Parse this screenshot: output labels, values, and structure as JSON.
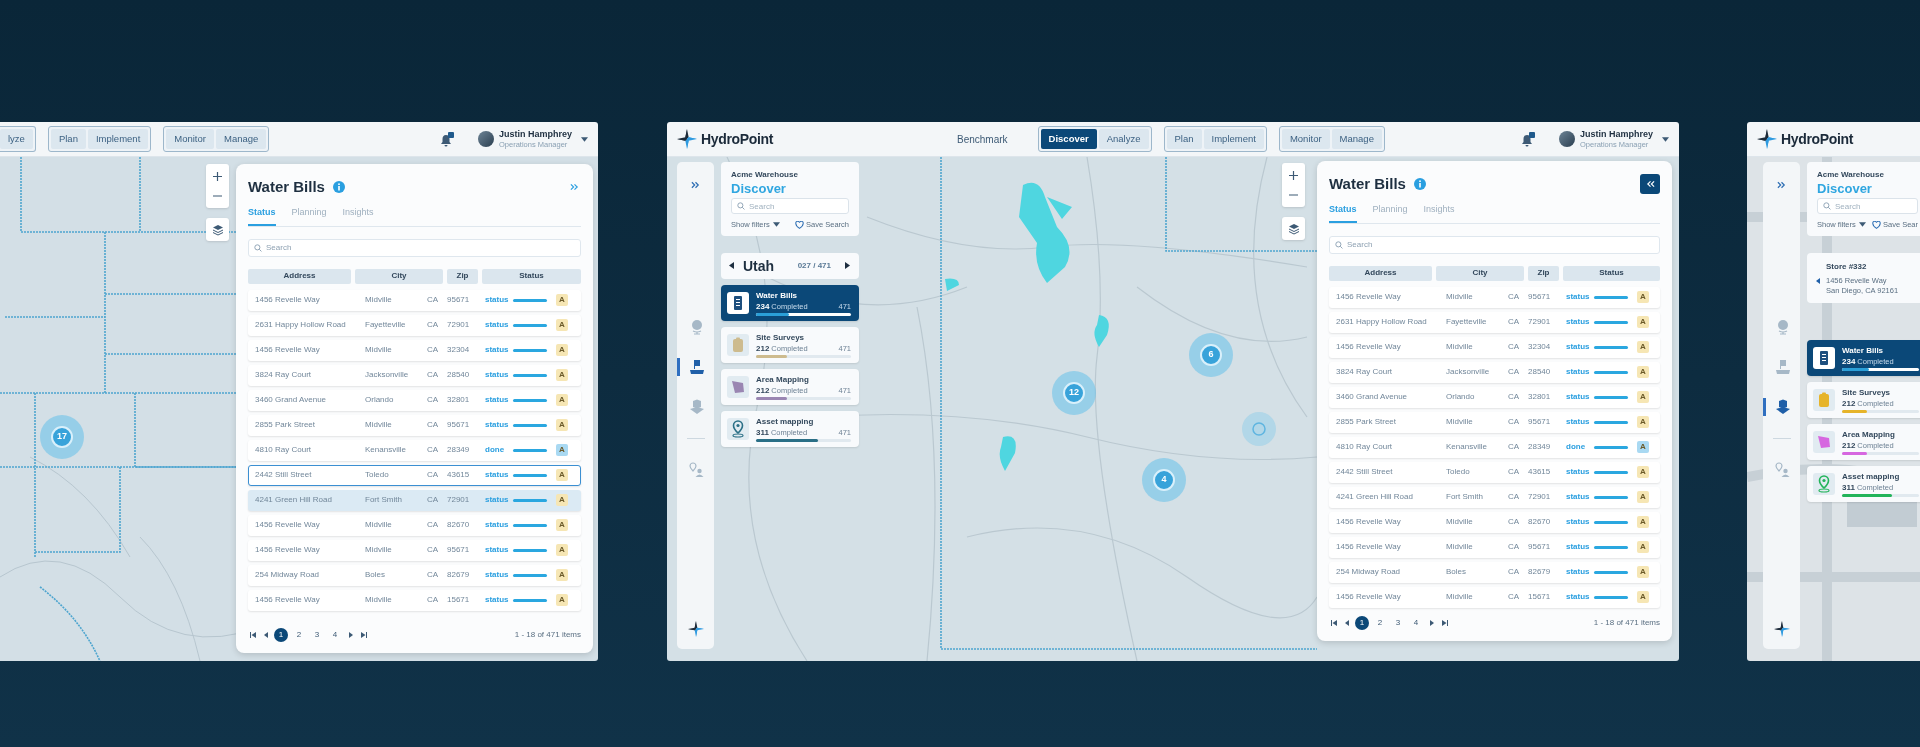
{
  "screens": [
    {
      "kind": "table_view",
      "header": {
        "nav_groups": [
          [
            {
              "label": "lyze",
              "selected": false
            }
          ],
          [
            {
              "label": "Plan",
              "selected": false
            },
            {
              "label": "Implement",
              "selected": false
            }
          ],
          [
            {
              "label": "Monitor",
              "selected": false
            },
            {
              "label": "Manage",
              "selected": false
            }
          ]
        ],
        "notification": true,
        "user": {
          "name": "Justin Hamphrey",
          "role": "Operations Manager"
        }
      },
      "map": {
        "clusters": [
          {
            "label": "17"
          }
        ]
      },
      "panel": {
        "title": "Water Bills",
        "toggle_active": false,
        "tabs": [
          {
            "label": "Status",
            "selected": true
          },
          {
            "label": "Planning",
            "selected": false
          },
          {
            "label": "Insights",
            "selected": false
          }
        ],
        "search_placeholder": "Search",
        "columns": [
          "Address",
          "City",
          "Zip",
          "Status"
        ],
        "rows": [
          {
            "address": "1456 Revelle Way",
            "city": "Midville",
            "state": "CA",
            "zip": "95671",
            "status": "status",
            "badge": "A",
            "color": "#f6e6b4",
            "selected": false,
            "hovered": false
          },
          {
            "address": "2631 Happy Hollow Road",
            "city": "Fayetteville",
            "state": "CA",
            "zip": "72901",
            "status": "status",
            "badge": "A",
            "color": "#f6e6b4",
            "selected": false,
            "hovered": false
          },
          {
            "address": "1456 Revelle Way",
            "city": "Midville",
            "state": "CA",
            "zip": "32304",
            "status": "status",
            "badge": "A",
            "color": "#f6e6b4",
            "selected": false,
            "hovered": false
          },
          {
            "address": "3824 Ray Court",
            "city": "Jacksonville",
            "state": "CA",
            "zip": "28540",
            "status": "status",
            "badge": "A",
            "color": "#f6e6b4",
            "selected": false,
            "hovered": false
          },
          {
            "address": "3460 Grand Avenue",
            "city": "Orlando",
            "state": "CA",
            "zip": "32801",
            "status": "status",
            "badge": "A",
            "color": "#f6e6b4",
            "selected": false,
            "hovered": false
          },
          {
            "address": "2855 Park Street",
            "city": "Midville",
            "state": "CA",
            "zip": "95671",
            "status": "status",
            "badge": "A",
            "color": "#f6e6b4",
            "selected": false,
            "hovered": false
          },
          {
            "address": "4810 Ray Court",
            "city": "Kenansville",
            "state": "CA",
            "zip": "28349",
            "status": "done",
            "badge": "A",
            "color": "#a9d9f2",
            "selected": false,
            "hovered": false
          },
          {
            "address": "2442 Still Street",
            "city": "Toledo",
            "state": "CA",
            "zip": "43615",
            "status": "status",
            "badge": "A",
            "color": "#f6e6b4",
            "selected": true,
            "hovered": false
          },
          {
            "address": "4241 Green Hill Road",
            "city": "Fort Smith",
            "state": "CA",
            "zip": "72901",
            "status": "status",
            "badge": "A",
            "color": "#f6e6b4",
            "selected": false,
            "hovered": true
          },
          {
            "address": "1456 Revelle Way",
            "city": "Midville",
            "state": "CA",
            "zip": "82670",
            "status": "status",
            "badge": "A",
            "color": "#f6e6b4",
            "selected": false,
            "hovered": false
          },
          {
            "address": "1456 Revelle Way",
            "city": "Midville",
            "state": "CA",
            "zip": "95671",
            "status": "status",
            "badge": "A",
            "color": "#f6e6b4",
            "selected": false,
            "hovered": false
          },
          {
            "address": "254 Midway Road",
            "city": "Boles",
            "state": "CA",
            "zip": "82679",
            "status": "status",
            "badge": "A",
            "color": "#f6e6b4",
            "selected": false,
            "hovered": false
          },
          {
            "address": "1456 Revelle Way",
            "city": "Midville",
            "state": "CA",
            "zip": "15671",
            "status": "status",
            "badge": "A",
            "color": "#f6e6b4",
            "selected": false,
            "hovered": false
          }
        ],
        "pages": [
          {
            "label": "1",
            "selected": true
          },
          {
            "label": "2",
            "selected": false
          },
          {
            "label": "3",
            "selected": false
          },
          {
            "label": "4",
            "selected": false
          }
        ],
        "summary": "1 - 18 of 471 items"
      }
    },
    {
      "kind": "discover_view",
      "header": {
        "logo": "HydroPoint",
        "links": [
          "Benchmark"
        ],
        "nav_groups": [
          [
            {
              "label": "Discover",
              "selected": true
            },
            {
              "label": "Analyze",
              "selected": false
            }
          ],
          [
            {
              "label": "Plan",
              "selected": false
            },
            {
              "label": "Implement",
              "selected": false
            }
          ],
          [
            {
              "label": "Monitor",
              "selected": false
            },
            {
              "label": "Manage",
              "selected": false
            }
          ]
        ],
        "notification": true,
        "user": {
          "name": "Justin Hamphrey",
          "role": "Operations Manager"
        }
      },
      "sidebar": {
        "items": [
          {
            "kind": "globe",
            "selected": false
          },
          {
            "kind": "site",
            "selected": true
          },
          {
            "kind": "warehouse",
            "selected": false
          },
          {
            "kind": "pin",
            "selected": false
          }
        ]
      },
      "discover": {
        "account": "Acme Warehouse",
        "title": "Discover",
        "search_placeholder": "Search",
        "filters_label": "Show filters",
        "save_label": "Save Search"
      },
      "region_nav": {
        "name": "Utah",
        "count": "027 / 471"
      },
      "cards": [
        {
          "kind": "bill",
          "title": "Water Bills",
          "count": "234",
          "count_label": "Completed",
          "total": "471",
          "level": 0.35,
          "color": "#2a9fd8",
          "selected": true
        },
        {
          "kind": "survey",
          "title": "Site Surveys",
          "count": "212",
          "count_label": "Completed",
          "total": "471",
          "level": 0.33,
          "color": "#cdbb8e",
          "selected": false
        },
        {
          "kind": "area",
          "title": "Area Mapping",
          "count": "212",
          "count_label": "Completed",
          "total": "471",
          "level": 0.33,
          "color": "#9a86b2",
          "selected": false
        },
        {
          "kind": "asset",
          "title": "Asset mapping",
          "count": "311",
          "count_label": "Completed",
          "total": "471",
          "level": 0.65,
          "color": "#2a6f86",
          "selected": false
        }
      ],
      "map": {
        "clusters": [
          {
            "label": "12"
          },
          {
            "label": "6"
          },
          {
            "label": "4"
          }
        ]
      },
      "panel": {
        "title": "Water Bills",
        "toggle_active": true,
        "tabs": [
          {
            "label": "Status",
            "selected": true
          },
          {
            "label": "Planning",
            "selected": false
          },
          {
            "label": "Insights",
            "selected": false
          }
        ],
        "search_placeholder": "Search",
        "columns": [
          "Address",
          "City",
          "Zip",
          "Status"
        ],
        "rows": [
          {
            "address": "1456 Revelle Way",
            "city": "Midville",
            "state": "CA",
            "zip": "95671",
            "status": "status",
            "badge": "A",
            "color": "#f6e6b4",
            "selected": false,
            "hovered": false
          },
          {
            "address": "2631 Happy Hollow Road",
            "city": "Fayetteville",
            "state": "CA",
            "zip": "72901",
            "status": "status",
            "badge": "A",
            "color": "#f6e6b4",
            "selected": false,
            "hovered": false
          },
          {
            "address": "1456 Revelle Way",
            "city": "Midville",
            "state": "CA",
            "zip": "32304",
            "status": "status",
            "badge": "A",
            "color": "#f6e6b4",
            "selected": false,
            "hovered": false
          },
          {
            "address": "3824 Ray Court",
            "city": "Jacksonville",
            "state": "CA",
            "zip": "28540",
            "status": "status",
            "badge": "A",
            "color": "#f6e6b4",
            "selected": false,
            "hovered": false
          },
          {
            "address": "3460 Grand Avenue",
            "city": "Orlando",
            "state": "CA",
            "zip": "32801",
            "status": "status",
            "badge": "A",
            "color": "#f6e6b4",
            "selected": false,
            "hovered": false
          },
          {
            "address": "2855 Park Street",
            "city": "Midville",
            "state": "CA",
            "zip": "95671",
            "status": "status",
            "badge": "A",
            "color": "#f6e6b4",
            "selected": false,
            "hovered": false
          },
          {
            "address": "4810 Ray Court",
            "city": "Kenansville",
            "state": "CA",
            "zip": "28349",
            "status": "done",
            "badge": "A",
            "color": "#a9d9f2",
            "selected": false,
            "hovered": false
          },
          {
            "address": "2442 Still Street",
            "city": "Toledo",
            "state": "CA",
            "zip": "43615",
            "status": "status",
            "badge": "A",
            "color": "#f6e6b4",
            "selected": false,
            "hovered": false
          },
          {
            "address": "4241 Green Hill Road",
            "city": "Fort Smith",
            "state": "CA",
            "zip": "72901",
            "status": "status",
            "badge": "A",
            "color": "#f6e6b4",
            "selected": false,
            "hovered": false
          },
          {
            "address": "1456 Revelle Way",
            "city": "Midville",
            "state": "CA",
            "zip": "82670",
            "status": "status",
            "badge": "A",
            "color": "#f6e6b4",
            "selected": false,
            "hovered": false
          },
          {
            "address": "1456 Revelle Way",
            "city": "Midville",
            "state": "CA",
            "zip": "95671",
            "status": "status",
            "badge": "A",
            "color": "#f6e6b4",
            "selected": false,
            "hovered": false
          },
          {
            "address": "254 Midway Road",
            "city": "Boles",
            "state": "CA",
            "zip": "82679",
            "status": "status",
            "badge": "A",
            "color": "#f6e6b4",
            "selected": false,
            "hovered": false
          },
          {
            "address": "1456 Revelle Way",
            "city": "Midville",
            "state": "CA",
            "zip": "15671",
            "status": "status",
            "badge": "A",
            "color": "#f6e6b4",
            "selected": false,
            "hovered": false
          }
        ],
        "pages": [
          {
            "label": "1",
            "selected": true
          },
          {
            "label": "2",
            "selected": false
          },
          {
            "label": "3",
            "selected": false
          },
          {
            "label": "4",
            "selected": false
          }
        ],
        "summary": "1 - 18 of 471 items"
      }
    },
    {
      "kind": "store_view",
      "header": {
        "logo": "HydroPoint"
      },
      "sidebar": {
        "items": [
          {
            "kind": "globe",
            "selected": false
          },
          {
            "kind": "site",
            "selected": false
          },
          {
            "kind": "warehouse",
            "selected": true
          },
          {
            "kind": "pin",
            "selected": false
          }
        ]
      },
      "discover": {
        "account": "Acme Warehouse",
        "title": "Discover",
        "search_placeholder": "Search",
        "filters_label": "Show filters",
        "save_label": "Save Sear"
      },
      "store": {
        "name": "Store #332",
        "address_line1": "1456 Revelle Way",
        "address_line2": "San Diego, CA 92161"
      },
      "cards": [
        {
          "kind": "bill",
          "title": "Water Bills",
          "count": "234",
          "count_label": "Completed",
          "level": 0.35,
          "color": "#2a9fd8",
          "selected": true
        },
        {
          "kind": "survey",
          "title": "Site Surveys",
          "count": "212",
          "count_label": "Completed",
          "level": 0.33,
          "color": "#e6b42a",
          "selected": false
        },
        {
          "kind": "area",
          "title": "Area Mapping",
          "count": "212",
          "count_label": "Completed",
          "level": 0.33,
          "color": "#d667e0",
          "selected": false
        },
        {
          "kind": "asset",
          "title": "Asset mapping",
          "count": "311",
          "count_label": "Completed",
          "level": 0.65,
          "color": "#22b45a",
          "selected": false
        }
      ]
    }
  ]
}
